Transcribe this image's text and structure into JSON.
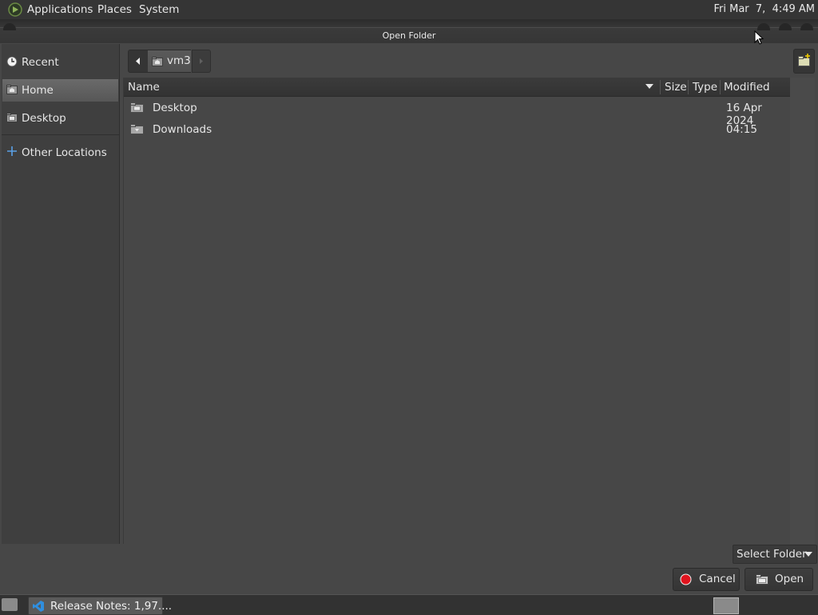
{
  "top_panel": {
    "menus": [
      "Applications",
      "Places",
      "System"
    ],
    "clock": "Fri Mar  7,  4:49 AM"
  },
  "dialog": {
    "title": "Open Folder"
  },
  "sidebar": {
    "items": [
      {
        "label": "Recent",
        "icon": "recent-clock-icon"
      },
      {
        "label": "Home",
        "icon": "home-folder-icon",
        "active": true
      },
      {
        "label": "Desktop",
        "icon": "desktop-folder-icon"
      },
      {
        "label": "Other Locations",
        "icon": "plus-icon"
      }
    ]
  },
  "path_bar": {
    "current": "vm3"
  },
  "file_list": {
    "columns": [
      "Name",
      "Size",
      "Type",
      "Modified"
    ],
    "rows": [
      {
        "name": "Desktop",
        "size": "",
        "type": "",
        "modified": "16 Apr 2024",
        "icon": "desktop-folder-icon"
      },
      {
        "name": "Downloads",
        "size": "",
        "type": "",
        "modified": "04:15",
        "icon": "downloads-folder-icon"
      }
    ]
  },
  "filter": {
    "selected": "Select Folder"
  },
  "buttons": {
    "cancel": "Cancel",
    "open": "Open"
  },
  "taskbar": {
    "task_label": "Release Notes: 1,97...."
  },
  "colors": {
    "background": "#474747",
    "panel": "#353535",
    "active_item": "#5f5f5f",
    "cancel_icon": "#e0141e",
    "text": "#e6e6e6"
  }
}
